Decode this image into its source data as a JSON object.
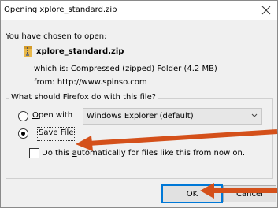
{
  "dialog": {
    "title": "Opening xplore_standard.zip",
    "intro": "You have chosen to open:",
    "file_name": "xplore_standard.zip",
    "type_line": "which is:  Compressed (zipped) Folder (4.2 MB)",
    "from_line": "from:  http://www.spinso.com",
    "question": "What should Firefox do with this file?",
    "open_with": {
      "label_prefix": "",
      "accel": "O",
      "label_rest": "pen with",
      "selected": false
    },
    "app_select": {
      "value": "Windows Explorer (default)"
    },
    "save_file": {
      "accel": "S",
      "label_rest": "ave File",
      "selected": true
    },
    "auto": {
      "label_pre": "Do this ",
      "accel": "a",
      "label_post": "utomatically for files like this from now on.",
      "checked": false
    },
    "buttons": {
      "ok": "OK",
      "cancel": "Cancel"
    }
  },
  "annotations": {
    "arrow_color": "#d4501a"
  },
  "icons": {
    "close": "close-icon",
    "file": "zip-file-icon",
    "dropdown": "chevron-down-icon"
  }
}
